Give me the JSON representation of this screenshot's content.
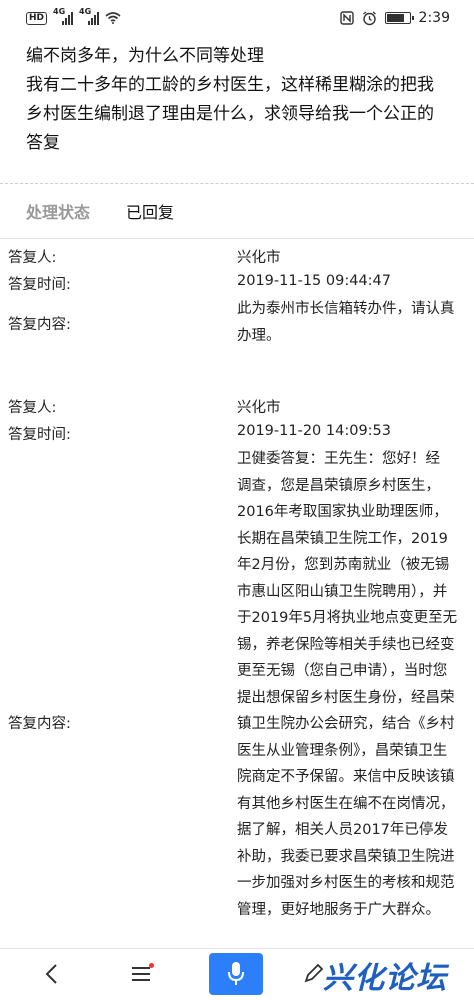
{
  "status_bar": {
    "hd_badge": "HD",
    "signal_1_label": "4G",
    "signal_2_label": "4G",
    "time": "2:39",
    "icons": [
      "hd-icon",
      "signal-icon",
      "wifi-icon",
      "nfc-icon",
      "alarm-icon",
      "battery-icon"
    ]
  },
  "question": {
    "title": "编不岗多年，为什么不同等处理",
    "body_lines": [
      "我有二十多年的工龄的乡村医生，这样稀里糊涂的把我",
      "乡村医生编制退了理由是什么，求领导给我一个公正的",
      "答复"
    ]
  },
  "status": {
    "label": "处理状态",
    "value": "已回复"
  },
  "replies": [
    {
      "replier_label": "答复人:",
      "replier": "兴化市",
      "time_label": "答复时间:",
      "time": "2019-11-15 09:44:47",
      "content_label": "答复内容:",
      "content_lines": [
        "此为泰州市长信箱转办件，请认真",
        "办理。"
      ]
    },
    {
      "replier_label": "答复人:",
      "replier": "兴化市",
      "time_label": "答复时间:",
      "time": "2019-11-20 14:09:53",
      "content_label": "答复内容:",
      "content_lines": [
        "卫健委答复：王先生：您好！经",
        "调查，您是昌荣镇原乡村医生，",
        "2016年考取国家执业助理医师，",
        "长期在昌荣镇卫生院工作，2019",
        "年2月份，您到苏南就业（被无锡",
        "市惠山区阳山镇卫生院聘用），并",
        "于2019年5月将执业地点变更至无",
        "锡，养老保险等相关手续也已经变",
        "更至无锡（您自己申请），当时您",
        "提出想保留乡村医生身份，经昌荣",
        "镇卫生院办公会研究，结合《乡村",
        "医生从业管理条例》，昌荣镇卫生",
        "院商定不予保留。来信中反映该镇",
        "有其他乡村医生在编不在岗情况，",
        "据了解，相关人员2017年已停发",
        "补助，我委已要求昌荣镇卫生院进",
        "一步加强对乡村医生的考核和规范",
        "管理，更好地服务于广大群众。"
      ]
    }
  ],
  "bottom_nav": {
    "icons": [
      "back-icon",
      "menu-icon",
      "microphone-icon",
      "edit-icon"
    ],
    "watermark": "兴化论坛",
    "mic_color": "#2d7ff9"
  }
}
